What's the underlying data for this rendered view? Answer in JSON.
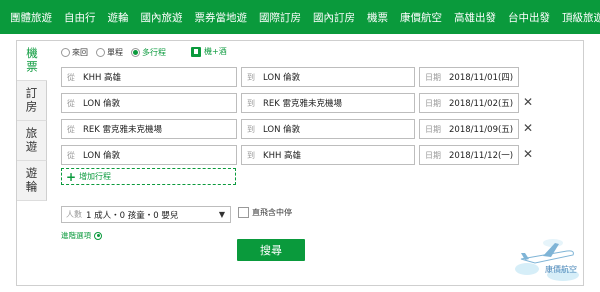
{
  "nav": [
    "團體旅遊",
    "自由行",
    "遊輪",
    "國內旅遊",
    "票券當地遊",
    "國際訂房",
    "國內訂房",
    "機票",
    "康價航空",
    "高雄出發",
    "台中出發",
    "頂級旅遊"
  ],
  "tabs": [
    "機票",
    "訂房",
    "旅遊",
    "遊輪"
  ],
  "trip_types": [
    {
      "label": "來回",
      "selected": false
    },
    {
      "label": "單程",
      "selected": false
    },
    {
      "label": "多行程",
      "selected": true
    }
  ],
  "hotel_label": "機+酒",
  "labels": {
    "from": "從",
    "to": "到",
    "date": "日期",
    "people": "人數"
  },
  "segments": [
    {
      "from": "KHH 高雄",
      "to": "LON 倫敦",
      "date": "2018/11/01(四)",
      "removable": false
    },
    {
      "from": "LON 倫敦",
      "to": "REK 雷克雅未克機場",
      "date": "2018/11/02(五)",
      "removable": true
    },
    {
      "from": "REK 雷克雅未克機場",
      "to": "LON 倫敦",
      "date": "2018/11/09(五)",
      "removable": true
    },
    {
      "from": "LON 倫敦",
      "to": "KHH 高雄",
      "date": "2018/11/12(一)",
      "removable": true
    }
  ],
  "remove_glyph": "✕",
  "add_label": "增加行程",
  "people_value": "1 成人・0 孩童・0 嬰兒",
  "direct_label": "直飛含中停",
  "advanced_label": "進階選項",
  "search_label": "搜尋",
  "logo_text": "康價航空",
  "colors": {
    "primary": "#0a9a3c"
  }
}
